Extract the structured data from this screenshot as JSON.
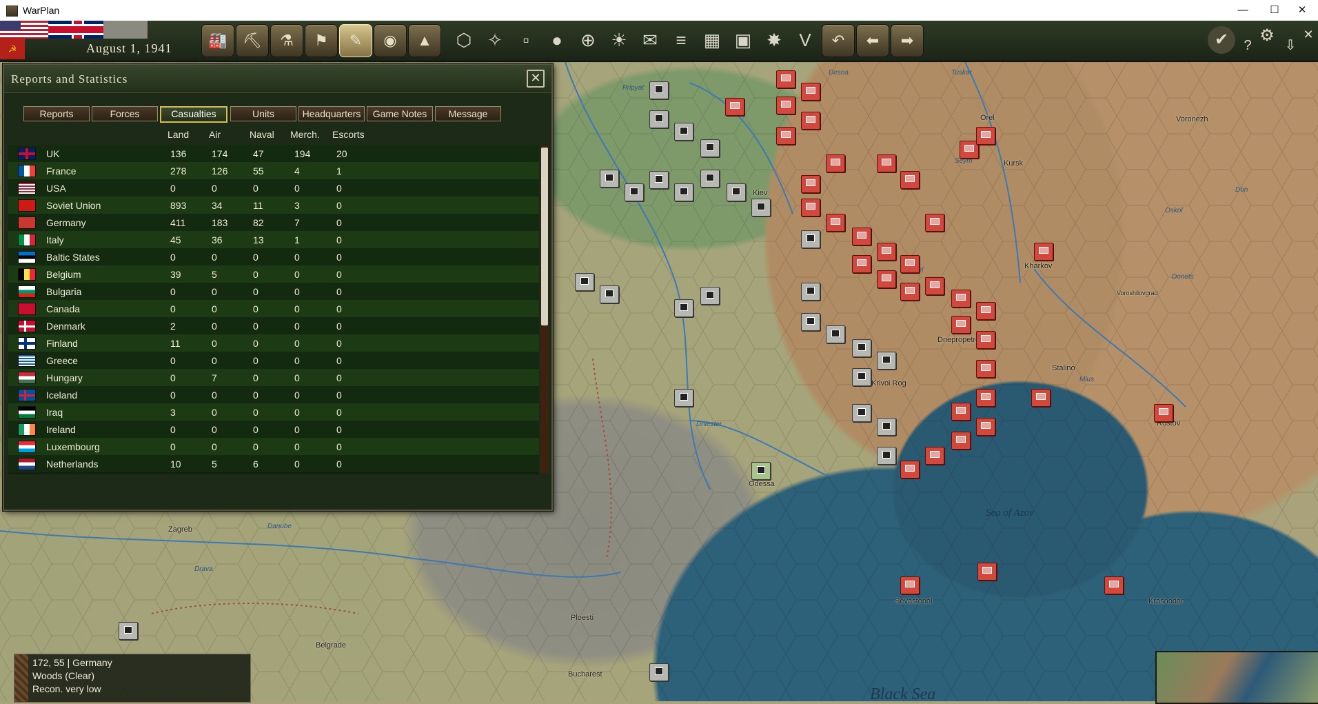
{
  "window": {
    "title": "WarPlan",
    "min_icon": "minimize-icon",
    "max_icon": "maximize-icon",
    "close_icon": "close-icon"
  },
  "game": {
    "date": "August 1, 1941"
  },
  "toolbar": {
    "buttons": [
      "production-icon",
      "naval-icon",
      "research-icon",
      "flag-icon",
      "reports-icon",
      "binoculars-icon",
      "helmet-icon"
    ],
    "tools": [
      "hex-icon",
      "hexes-icon",
      "tank-icon",
      "coins-icon",
      "target-icon",
      "sun-icon",
      "mail-icon",
      "bars-icon",
      "grid-icon",
      "square-icon",
      "explosion-icon",
      "v-icon",
      "undo-icon",
      "back-arrow-icon",
      "forward-arrow-icon"
    ],
    "right": [
      "checkmark-icon",
      "help-icon",
      "settings-icon",
      "save-icon"
    ]
  },
  "map": {
    "towns": [
      "Orel",
      "Kursk",
      "Voronezh",
      "Kharkov",
      "Voroshilovgrad",
      "Dnepropetrovsk",
      "Stalino",
      "Rostov",
      "Krivoi Rog",
      "Odessa",
      "Sevastopol",
      "Krasnodar",
      "Kiev",
      "Zagreb",
      "Belgrade",
      "Ploesti",
      "Bucharest"
    ],
    "rivers": [
      "Pripyat",
      "Desna",
      "Tuskar",
      "Seym",
      "Oskol",
      "Don",
      "Donets",
      "Dniester",
      "Danube",
      "Drava",
      "Psel",
      "Mius"
    ],
    "sea_azov": "Sea of Azov",
    "sea_black": "Black Sea"
  },
  "panel": {
    "title": "Reports and Statistics",
    "close_icon": "close-x-icon",
    "tabs": [
      "Reports",
      "Forces",
      "Casualties",
      "Units",
      "Headquarters",
      "Game Notes",
      "Message"
    ],
    "active_tab": "Casualties",
    "columns": [
      "Land",
      "Air",
      "Naval",
      "Merch.",
      "Escorts"
    ],
    "rows": [
      {
        "flag": "uk-flag",
        "name": "UK",
        "land": "136",
        "air": "174",
        "naval": "47",
        "merch": "194",
        "escorts": "20"
      },
      {
        "flag": "france-flag",
        "name": "France",
        "land": "278",
        "air": "126",
        "naval": "55",
        "merch": "4",
        "escorts": "1"
      },
      {
        "flag": "usa-flag",
        "name": "USA",
        "land": "0",
        "air": "0",
        "naval": "0",
        "merch": "0",
        "escorts": "0"
      },
      {
        "flag": "soviet-flag",
        "name": "Soviet Union",
        "land": "893",
        "air": "34",
        "naval": "11",
        "merch": "3",
        "escorts": "0"
      },
      {
        "flag": "germany-flag",
        "name": "Germany",
        "land": "411",
        "air": "183",
        "naval": "82",
        "merch": "7",
        "escorts": "0"
      },
      {
        "flag": "italy-flag",
        "name": "Italy",
        "land": "45",
        "air": "36",
        "naval": "13",
        "merch": "1",
        "escorts": "0"
      },
      {
        "flag": "baltic-flag",
        "name": "Baltic States",
        "land": "0",
        "air": "0",
        "naval": "0",
        "merch": "0",
        "escorts": "0"
      },
      {
        "flag": "belgium-flag",
        "name": "Belgium",
        "land": "39",
        "air": "5",
        "naval": "0",
        "merch": "0",
        "escorts": "0"
      },
      {
        "flag": "bulgaria-flag",
        "name": "Bulgaria",
        "land": "0",
        "air": "0",
        "naval": "0",
        "merch": "0",
        "escorts": "0"
      },
      {
        "flag": "canada-flag",
        "name": "Canada",
        "land": "0",
        "air": "0",
        "naval": "0",
        "merch": "0",
        "escorts": "0"
      },
      {
        "flag": "denmark-flag",
        "name": "Denmark",
        "land": "2",
        "air": "0",
        "naval": "0",
        "merch": "0",
        "escorts": "0"
      },
      {
        "flag": "finland-flag",
        "name": "Finland",
        "land": "11",
        "air": "0",
        "naval": "0",
        "merch": "0",
        "escorts": "0"
      },
      {
        "flag": "greece-flag",
        "name": "Greece",
        "land": "0",
        "air": "0",
        "naval": "0",
        "merch": "0",
        "escorts": "0"
      },
      {
        "flag": "hungary-flag",
        "name": "Hungary",
        "land": "0",
        "air": "7",
        "naval": "0",
        "merch": "0",
        "escorts": "0"
      },
      {
        "flag": "iceland-flag",
        "name": "Iceland",
        "land": "0",
        "air": "0",
        "naval": "0",
        "merch": "0",
        "escorts": "0"
      },
      {
        "flag": "iraq-flag",
        "name": "Iraq",
        "land": "3",
        "air": "0",
        "naval": "0",
        "merch": "0",
        "escorts": "0"
      },
      {
        "flag": "ireland-flag",
        "name": "Ireland",
        "land": "0",
        "air": "0",
        "naval": "0",
        "merch": "0",
        "escorts": "0"
      },
      {
        "flag": "luxembourg-flag",
        "name": "Luxembourg",
        "land": "0",
        "air": "0",
        "naval": "0",
        "merch": "0",
        "escorts": "0"
      },
      {
        "flag": "netherlands-flag",
        "name": "Netherlands",
        "land": "10",
        "air": "5",
        "naval": "6",
        "merch": "0",
        "escorts": "0"
      }
    ]
  },
  "info": {
    "coords": "172, 55",
    "country": "Germany",
    "terrain": "Woods (Clear)",
    "recon": "Recon. very low"
  },
  "colors": {
    "soviet_unit": "#d2483c",
    "axis_unit": "#b8b8b2",
    "active_tab_border": "#d8bc5a"
  }
}
